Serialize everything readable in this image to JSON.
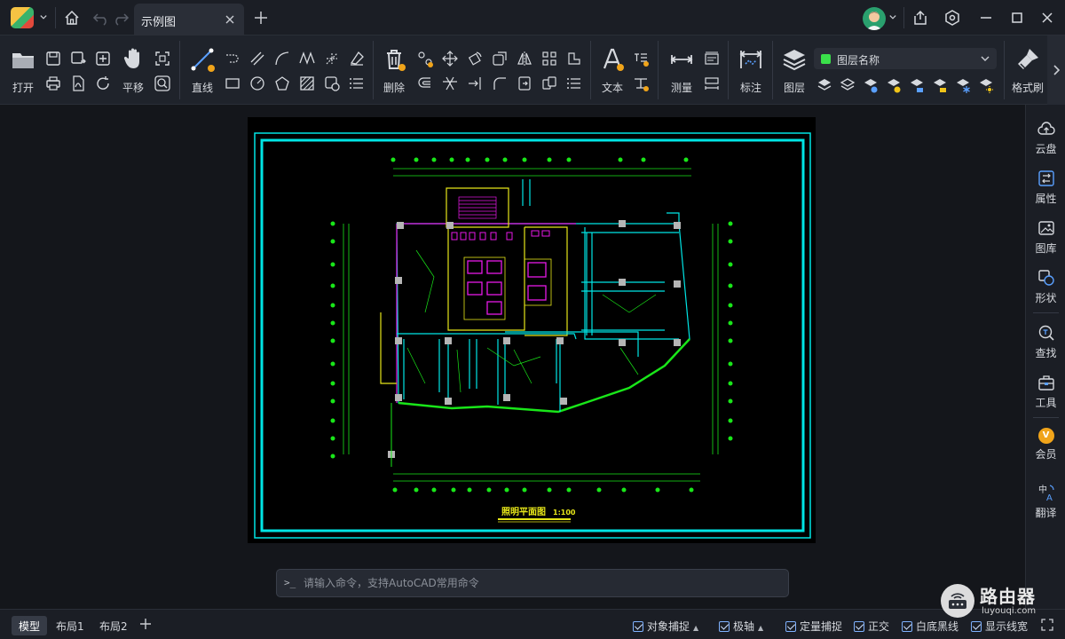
{
  "titlebar": {
    "tab_label": "示例图"
  },
  "ribbon": {
    "open_label": "打开",
    "pan_label": "平移",
    "line_label": "直线",
    "delete_label": "删除",
    "text_label": "文本",
    "measure_label": "测量",
    "annotate_label": "标注",
    "layer_label": "图层",
    "layer_select_value": "图层名称",
    "format_brush_label": "格式刷"
  },
  "sidebar": {
    "items": [
      {
        "label": "云盘",
        "icon": "cloud-icon"
      },
      {
        "label": "属性",
        "icon": "properties-icon"
      },
      {
        "label": "图库",
        "icon": "gallery-icon"
      },
      {
        "label": "形状",
        "icon": "shape-icon"
      },
      {
        "label": "查找",
        "icon": "search-icon"
      },
      {
        "label": "工具",
        "icon": "toolbox-icon"
      },
      {
        "label": "会员",
        "icon": "vip-icon",
        "badge": "V"
      },
      {
        "label": "翻译",
        "icon": "translate-icon"
      }
    ]
  },
  "drawing": {
    "title": "照明平面图",
    "scale": "1:100"
  },
  "command": {
    "prompt": ">_",
    "placeholder": "请输入命令，支持AutoCAD常用命令"
  },
  "statusbar": {
    "tabs": [
      "模型",
      "布局1",
      "布局2"
    ],
    "toggles": [
      "对象捕捉",
      "极轴",
      "定量捕捉",
      "正交",
      "白底黑线",
      "显示线宽"
    ]
  },
  "watermark": {
    "title": "路由器",
    "subtitle": "luyouqi.com"
  },
  "colors": {
    "accent": "#3ae04a",
    "cad_cyan": "#00e5e5",
    "cad_green": "#19e619",
    "cad_magenta": "#e619e6",
    "cad_yellow": "#e6e619"
  }
}
